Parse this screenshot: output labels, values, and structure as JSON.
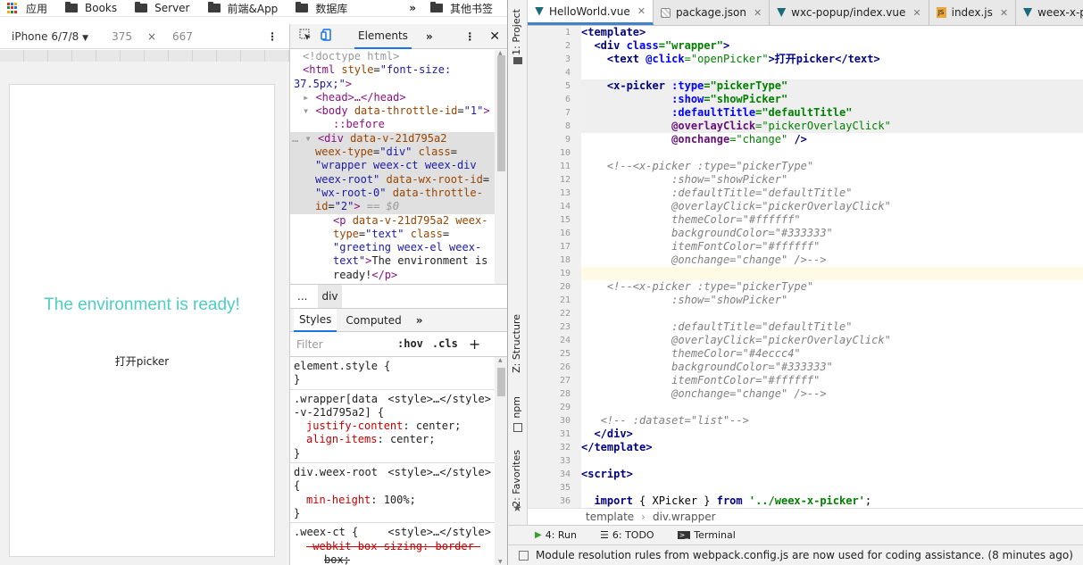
{
  "bookmarks": {
    "apps_label": "应用",
    "items": [
      "Books",
      "Server",
      "前端&App",
      "数据库"
    ],
    "more": "»",
    "other_label": "其他书签"
  },
  "device_toolbar": {
    "device": "iPhone 6/7/8",
    "width": "375",
    "times": "×",
    "height": "667"
  },
  "page": {
    "greeting": "The environment is ready!",
    "picker_text": "打开picker",
    "greeting_color": "#4ecdc4"
  },
  "devtools": {
    "tabs": {
      "elements": "Elements",
      "more": "»"
    },
    "dom": {
      "doctype": "<!doctype html>",
      "html_open": "<html",
      "html_attr": "style",
      "html_val": "\"font-size:",
      "html_val2": "37.5px;\"",
      "head": "<head>…</head>",
      "body_open": "<body",
      "body_attr": "data-throttle-id",
      "body_val": "\"1\"",
      "before": "::before",
      "div_tag": "<div",
      "div_attr1": "data-v-21d795a2",
      "div_attr2": "weex-type",
      "div_val2": "\"div\"",
      "div_attr3": "class",
      "div_val3a": "\"wrapper weex-ct weex-div",
      "div_val3b": "weex-root\"",
      "div_attr4": "data-wx-root-id",
      "div_val4": "\"wx-root-0\"",
      "div_attr5": "data-throttle-",
      "div_attr5b": "id",
      "div_val5": "\"2\"",
      "div_eq": "== $0",
      "p_tag": "<p",
      "p_attr1": "data-v-21d795a2",
      "p_attr1b": "weex-",
      "p_attr2": "type",
      "p_val2": "\"text\"",
      "p_attr3": "class",
      "p_val3a": "\"greeting weex-el weex-",
      "p_val3b": "text\"",
      "p_text1": "The environment is",
      "p_text2": "ready!",
      "p_close": "</p>"
    },
    "breadcrumb": {
      "dots": "...",
      "item": "div"
    },
    "styles_tabs": {
      "styles": "Styles",
      "computed": "Computed",
      "more": "»"
    },
    "filter": {
      "placeholder": "Filter",
      "hov": ":hov",
      "cls": ".cls",
      "plus": "+"
    },
    "rules": [
      {
        "selector": "element.style {",
        "source": "",
        "close": "}"
      },
      {
        "selector": ".wrapper[data",
        "selector2": "-v-21d795a2] {",
        "source": "<style>…</style>",
        "props": [
          [
            "justify-content",
            "center;"
          ],
          [
            "align-items",
            "center;"
          ]
        ],
        "close": "}"
      },
      {
        "selector": "div.weex-root",
        "selector2": "{",
        "source": "<style>…</style>",
        "props": [
          [
            "min-height",
            "100%;"
          ]
        ],
        "close": "}"
      },
      {
        "selector": ".weex-ct {",
        "source": "<style>…</style>",
        "struck1": "-webkit-box-sizing: border-",
        "struck2": "box;"
      }
    ]
  },
  "ide": {
    "sidebar": {
      "project": "1: Project",
      "structure": "Z: Structure",
      "npm": "npm",
      "favorites": "2: Favorites"
    },
    "tabs": [
      {
        "label": "HelloWorld.vue",
        "icon": "vue-icon",
        "active": true
      },
      {
        "label": "package.json",
        "icon": "json-icon",
        "active": false
      },
      {
        "label": "wxc-popup/index.vue",
        "icon": "vue-icon",
        "active": false
      },
      {
        "label": "index.js",
        "icon": "js-icon",
        "active": false
      },
      {
        "label": "weex-x-picker/inde",
        "icon": "vue-icon",
        "active": false
      }
    ],
    "line_numbers": [
      "1",
      "2",
      "3",
      "4",
      "5",
      "6",
      "7",
      "8",
      "9",
      "10",
      "11",
      "12",
      "13",
      "14",
      "15",
      "16",
      "17",
      "18",
      "19",
      "20",
      "21",
      "22",
      "23",
      "24",
      "25",
      "26",
      "27",
      "28",
      "29",
      "30",
      "31",
      "32",
      "33",
      "34",
      "35",
      "36"
    ],
    "code": {
      "l1": "<template>",
      "l2a": "<div ",
      "l2b": "class",
      "l2c": "=",
      "l2d": "\"wrapper\"",
      "l2e": ">",
      "l3a": "<text ",
      "l3b": "@click",
      "l3c": "=",
      "l3d": "\"openPicker\"",
      "l3e": ">打开picker</text>",
      "l5a": "<x-picker ",
      "l5b": ":type",
      "l5c": "=",
      "l5d": "\"pickerType\"",
      "l6b": ":show",
      "l6d": "\"showPicker\"",
      "l7b": ":defaultTitle",
      "l7d": "\"defaultTitle\"",
      "l8b": "@overlayClick",
      "l8d": "\"pickerOverlayClick\"",
      "l9b": "@onchange",
      "l9d": "\"change\"",
      "l9e": " />",
      "l11": "<!--<x-picker :type=\"pickerType\"",
      "l12": ":show=\"showPicker\"",
      "l13": ":defaultTitle=\"defaultTitle\"",
      "l14": "@overlayClick=\"pickerOverlayClick\"",
      "l15": "themeColor=\"#ffffff\"",
      "l16": "backgroundColor=\"#333333\"",
      "l17": "itemFontColor=\"#ffffff\"",
      "l18": "@onchange=\"change\" />-->",
      "l20": "<!--<x-picker :type=\"pickerType\"",
      "l21": ":show=\"showPicker\"",
      "l23": ":defaultTitle=\"defaultTitle\"",
      "l24": "@overlayClick=\"pickerOverlayClick\"",
      "l25": "themeColor=\"#4eccc4\"",
      "l26": "backgroundColor=\"#333333\"",
      "l27": "itemFontColor=\"#ffffff\"",
      "l28": "@onchange=\"change\" />-->",
      "l30": "<!-- :dataset=\"list\"-->",
      "l31": "</div>",
      "l32": "</template>",
      "l34": "<script>",
      "l36a": "import ",
      "l36b": "{ XPicker } ",
      "l36c": "from ",
      "l36d": "'../weex-x-picker'",
      "l36e": ";"
    },
    "breadcrumb": {
      "a": "template",
      "sep": "›",
      "b": "div.wrapper"
    },
    "toolwindows": {
      "run": "4: Run",
      "todo": "6: TODO",
      "terminal": "Terminal"
    },
    "status": "Module resolution rules from webpack.config.js are now used for coding assistance. (8 minutes ago)"
  }
}
